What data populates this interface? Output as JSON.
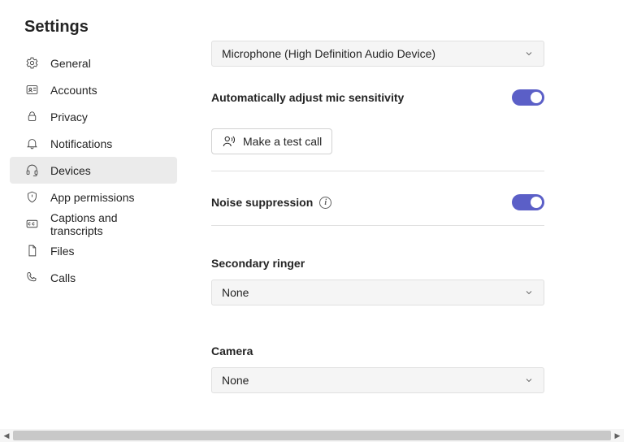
{
  "title": "Settings",
  "sidebar": {
    "items": [
      {
        "label": "General"
      },
      {
        "label": "Accounts"
      },
      {
        "label": "Privacy"
      },
      {
        "label": "Notifications"
      },
      {
        "label": "Devices"
      },
      {
        "label": "App permissions"
      },
      {
        "label": "Captions and transcripts"
      },
      {
        "label": "Files"
      },
      {
        "label": "Calls"
      }
    ]
  },
  "main": {
    "microphone_dropdown": "Microphone (High Definition Audio Device)",
    "auto_mic_label": "Automatically adjust mic sensitivity",
    "test_call_label": "Make a test call",
    "noise_label": "Noise suppression",
    "secondary_ringer_label": "Secondary ringer",
    "secondary_ringer_value": "None",
    "camera_label": "Camera",
    "camera_value": "None"
  }
}
